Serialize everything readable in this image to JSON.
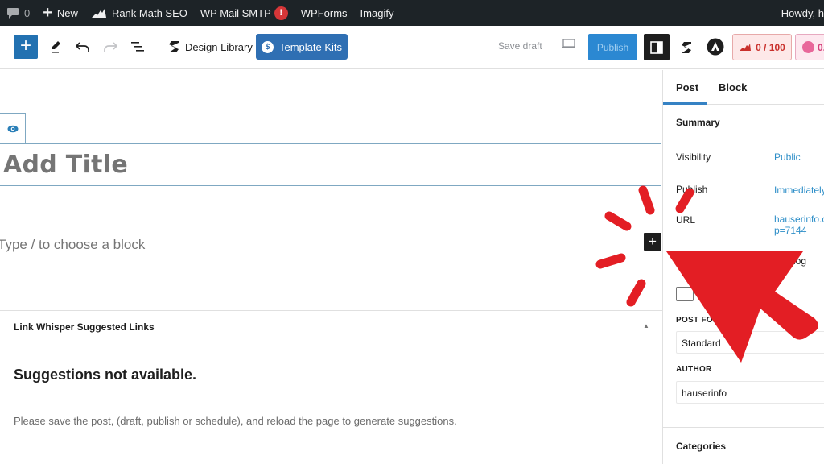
{
  "admin_bar": {
    "comments_count": "0",
    "new_label": "New",
    "rank_math_label": "Rank Math SEO",
    "wp_mail_smtp_label": "WP Mail SMTP",
    "wp_mail_smtp_badge": "!",
    "wpforms_label": "WPForms",
    "imagify_label": "Imagify",
    "howdy_label": "Howdy, h"
  },
  "toolbar": {
    "inserter_icon": "plus-icon",
    "tools_icon": "pencil-icon",
    "undo_icon": "undo-icon",
    "redo_icon": "redo-icon",
    "list_view_icon": "list-view-icon",
    "design_library_label": "Design Library",
    "template_kits_label": "Template Kits",
    "save_draft_label": "Save draft",
    "publish_label": "Publish",
    "rank_math_score": "0 / 100",
    "seo_score": "0."
  },
  "editor": {
    "title_placeholder": "Add Title",
    "block_placeholder": "Type / to choose a block"
  },
  "link_whisper": {
    "heading": "Link Whisper Suggested Links",
    "title": "Suggestions not available.",
    "message": "Please save the post, (draft, publish or schedule), and reload the page to generate suggestions."
  },
  "sidebar": {
    "tabs": [
      {
        "label": "Post",
        "active": true
      },
      {
        "label": "Block",
        "active": false
      }
    ],
    "summary_label": "Summary",
    "rows": [
      {
        "label": "Visibility",
        "value": "Public"
      },
      {
        "label": "Publish",
        "value": "Immediately"
      },
      {
        "label": "URL",
        "value": "hauserinfo.c",
        "value_line2": "p=7144"
      }
    ],
    "stick_partial": "log",
    "post_format_label": "POST FOR",
    "post_format_value": "Standard",
    "author_label": "AUTHOR",
    "author_value": "hauserinfo",
    "categories_label": "Categories"
  },
  "annotation": {
    "color": "#e31e24",
    "type": "arrow-with-burst"
  },
  "colors": {
    "admin_bar_bg": "#1d2327",
    "primary_blue": "#2271b1",
    "template_kits_blue": "#2f6fb3",
    "link_blue": "#2f8fc8",
    "rank_math_red": "#c9302c"
  }
}
